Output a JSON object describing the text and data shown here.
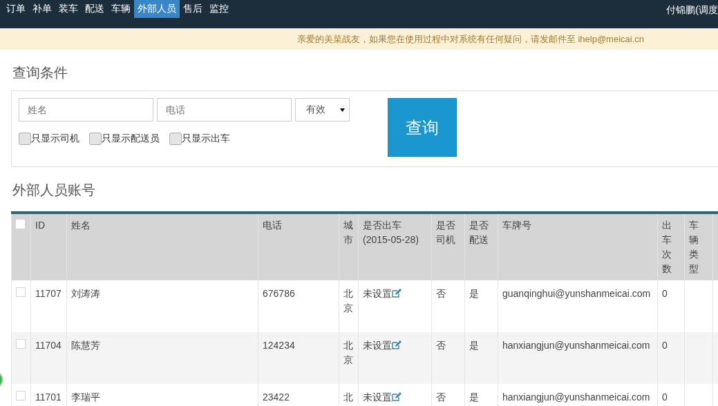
{
  "nav": {
    "items": [
      {
        "label": "订单",
        "selected": false
      },
      {
        "label": "补单",
        "selected": false
      },
      {
        "label": "装车",
        "selected": false
      },
      {
        "label": "配送",
        "selected": false
      },
      {
        "label": "车辆",
        "selected": false
      },
      {
        "label": "外部人员",
        "selected": true
      },
      {
        "label": "售后",
        "selected": false
      },
      {
        "label": "监控",
        "selected": false
      }
    ],
    "user": "付锦鹏(调度"
  },
  "notice": {
    "text": "亲爱的美菜战友，如果您在使用过程中对系统有任何疑问，请发邮件至 ihelp@meicai.cn"
  },
  "query": {
    "title": "查询条件",
    "name_field": {
      "placeholder": "姓名"
    },
    "phone_field": {
      "placeholder": "电话"
    },
    "status_select": {
      "value": "有效"
    },
    "filters": [
      {
        "label": "只显示司机",
        "checked": false
      },
      {
        "label": "只显示配送员",
        "checked": false
      },
      {
        "label": "只显示出车",
        "checked": false
      }
    ],
    "button": "查询"
  },
  "table": {
    "title": "外部人员账号",
    "select_all": {
      "checked": false
    },
    "columns": [
      "ID",
      "姓名",
      "电话",
      "城市",
      "是否出车 (2015-05-28)",
      "是否司机",
      "是否配送",
      "车牌号",
      "出车次数",
      "车辆类型"
    ],
    "rows": [
      {
        "checked": false,
        "cells": [
          "11707",
          "刘涛涛",
          "676786",
          "北京",
          "未设置",
          "否",
          "是",
          "guanqinghui@yunshanmeicai.com",
          "0",
          ""
        ]
      },
      {
        "checked": false,
        "cells": [
          "11704",
          "陈慧芳",
          "124234",
          "北京",
          "未设置",
          "否",
          "是",
          "hanxiangjun@yunshanmeicai.com",
          "0",
          ""
        ]
      },
      {
        "checked": false,
        "cells": [
          "11701",
          "李瑞平",
          "23422",
          "北",
          "未设置",
          "否",
          "是",
          "hanxiangjun@yunshanmeicai.com",
          "0",
          ""
        ]
      }
    ]
  }
}
